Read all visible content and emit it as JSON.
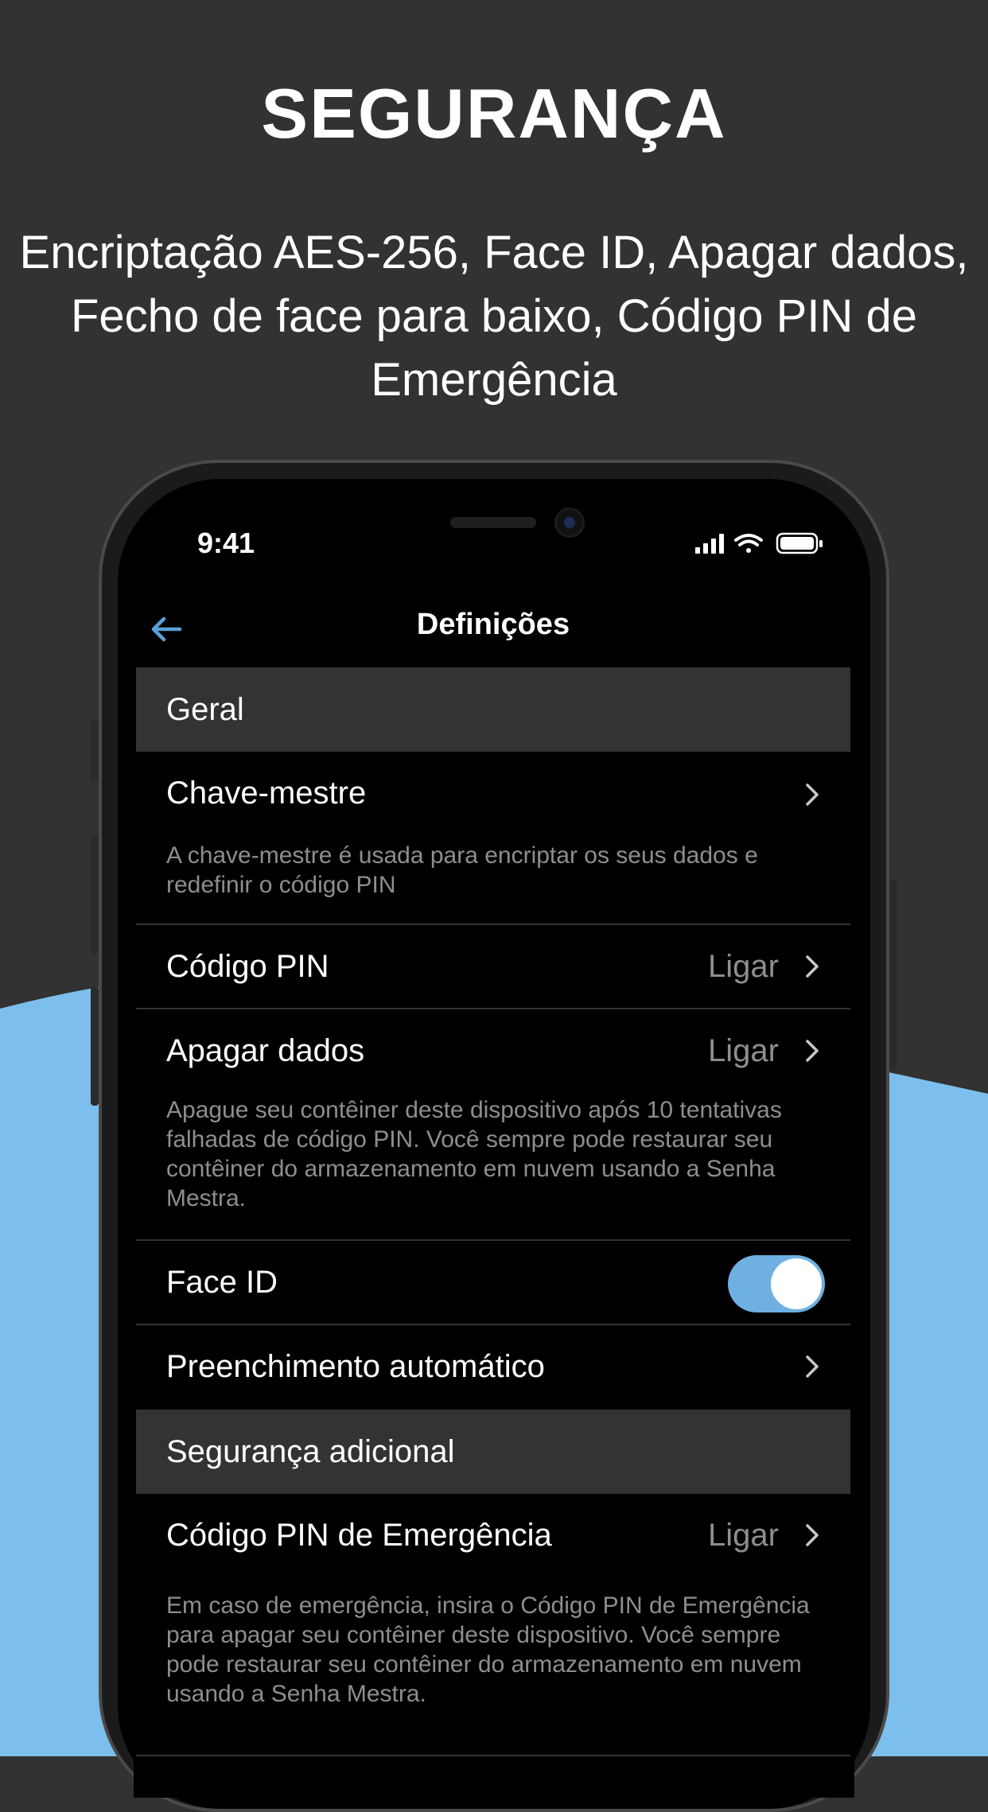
{
  "colors": {
    "background": "#323232",
    "wave": "#7dbfec",
    "accent": "#5a9fd6"
  },
  "promo": {
    "headline": "SEGURANÇA",
    "subline": "Encriptação AES-256, Face ID, Apagar dados, Fecho de face para baixo, Código PIN de Emergência"
  },
  "status_bar": {
    "time": "9:41",
    "icons": [
      "signal-icon",
      "wifi-icon",
      "battery-icon"
    ]
  },
  "navbar": {
    "back_icon": "arrow-left-icon",
    "title": "Definições"
  },
  "sections": {
    "general": {
      "header": "Geral",
      "master_key": {
        "title": "Chave-mestre",
        "description": "A chave-mestre é usada para encriptar os seus dados e redefinir o código PIN"
      },
      "pin_code": {
        "title": "Código PIN",
        "value": "Ligar"
      },
      "erase_data": {
        "title": "Apagar dados",
        "value": "Ligar",
        "description": "Apague seu contêiner deste dispositivo após 10 tentativas falhadas de código PIN. Você sempre pode restaurar seu contêiner do armazenamento em nuvem usando a Senha Mestra."
      },
      "face_id": {
        "title": "Face ID",
        "enabled": true
      },
      "autofill": {
        "title": "Preenchimento automático"
      }
    },
    "additional": {
      "header": "Segurança adicional",
      "emergency_pin": {
        "title": "Código PIN de Emergência",
        "value": "Ligar",
        "description": "Em caso de emergência, insira o Código PIN de Emergência para apagar seu contêiner deste dispositivo. Você sempre pode restaurar seu contêiner do armazenamento em nuvem usando a Senha Mestra."
      }
    }
  }
}
